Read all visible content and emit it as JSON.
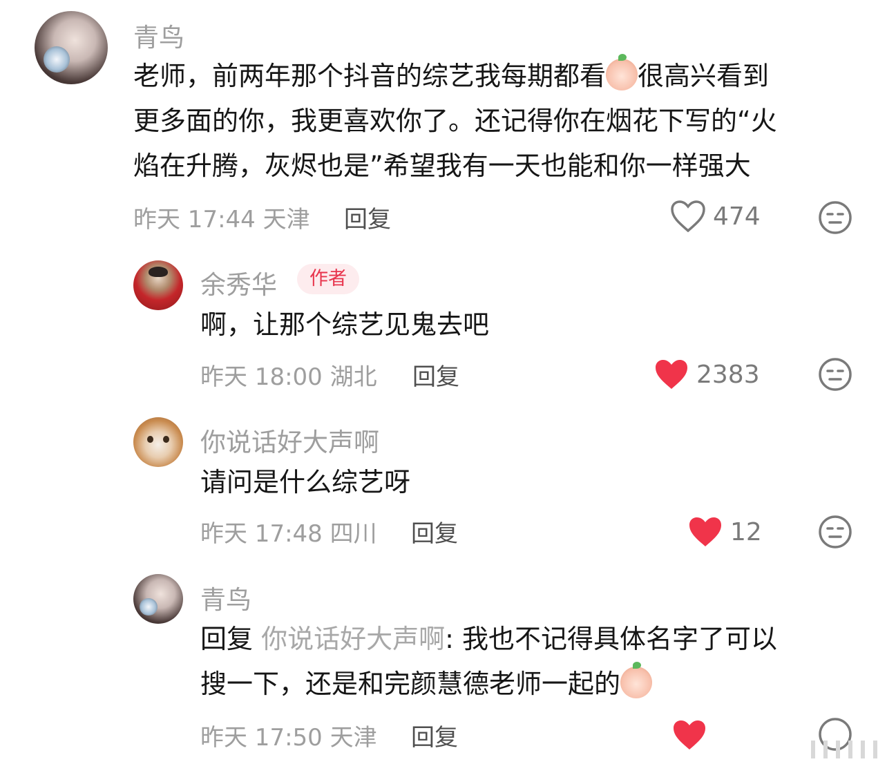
{
  "comments": [
    {
      "username": "青鸟",
      "text_lines": [
        "老师，前两年那个抖音的综艺我每期都看",
        "很高兴看到",
        "更多面的你，我更喜欢你了。还记得你在烟花下写的“火",
        "焰在升腾，灰烬也是”希望我有一天也能和你一样强大"
      ],
      "time": "昨天 17:44",
      "location": "天津",
      "reply_label": "回复",
      "likes": "474",
      "liked": false
    },
    {
      "username": "余秀华",
      "author_tag": "作者",
      "text": "啊，让那个综艺见鬼去吧",
      "time": "昨天 18:00",
      "location": "湖北",
      "reply_label": "回复",
      "likes": "2383",
      "liked": true
    },
    {
      "username": "你说话好大声啊",
      "text": "请问是什么综艺呀",
      "time": "昨天 17:48",
      "location": "四川",
      "reply_label": "回复",
      "likes": "12",
      "liked": true
    },
    {
      "username": "青鸟",
      "reply_prefix": "回复",
      "reply_target": "你说话好大声啊",
      "text_line1": ": 我也不记得具体名字了可以",
      "text_line2": "搜一下，还是和完颜慧德老师一起的",
      "time": "昨天 17:50",
      "location": "天津",
      "reply_label": "回复",
      "liked": true
    }
  ],
  "colors": {
    "like_red": "#f0344a",
    "username_gray": "#9e9e9e",
    "author_tag": "#e8354d"
  },
  "icons": {
    "like": "heart-icon",
    "dislike": "neutral-face-icon",
    "emoji1": "shy-face-emoji",
    "emoji2": "laughing-tears-emoji"
  }
}
